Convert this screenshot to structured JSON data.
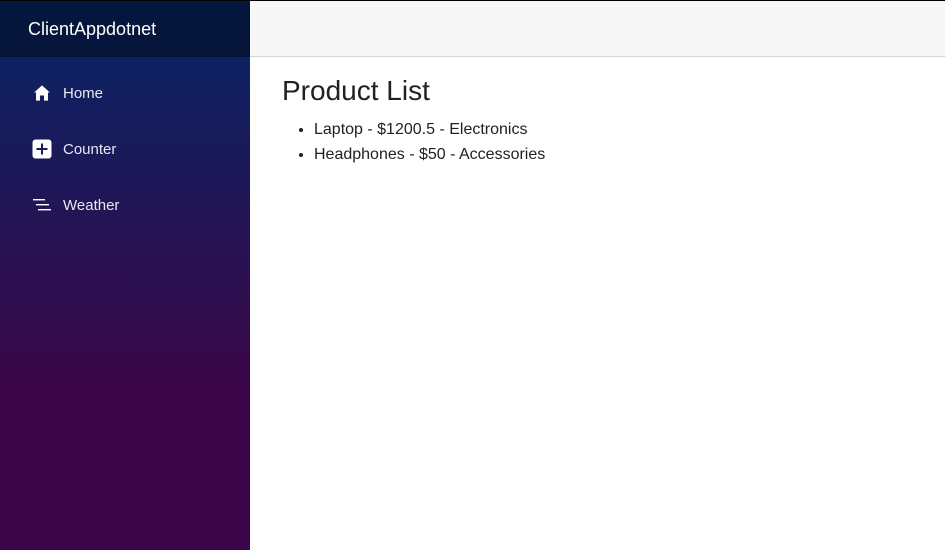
{
  "brand": {
    "title": "ClientAppdotnet"
  },
  "nav": {
    "items": [
      {
        "label": "Home",
        "icon": "home-icon"
      },
      {
        "label": "Counter",
        "icon": "plus-square-icon"
      },
      {
        "label": "Weather",
        "icon": "list-icon"
      }
    ]
  },
  "main": {
    "title": "Product List",
    "products": [
      "Laptop - $1200.5 - Electronics",
      "Headphones - $50 - Accessories"
    ]
  },
  "colors": {
    "sidebar_top": "#052767",
    "sidebar_bottom": "#3a0647",
    "top_row_bg": "#f7f7f7"
  }
}
